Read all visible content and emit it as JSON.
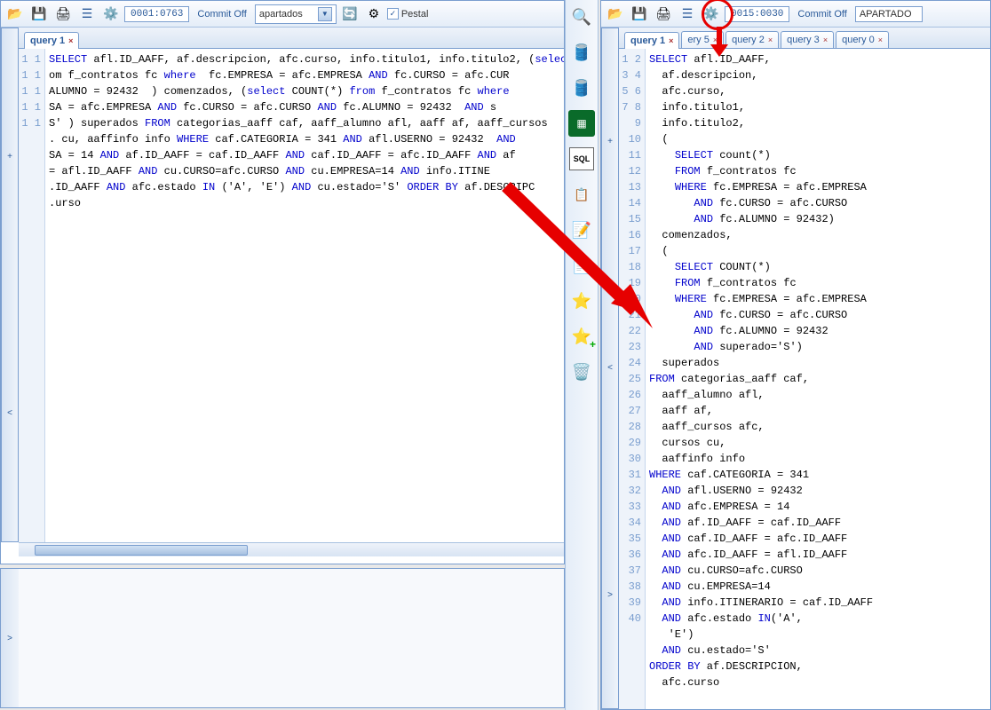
{
  "left": {
    "toolbar": {
      "status": "0001:0763",
      "commit": "Commit Off",
      "dropdown": "apartados",
      "checkbox_label": "Pestal",
      "checkbox_checked": true
    },
    "tabs": [
      {
        "label": "query 1",
        "active": true
      }
    ],
    "gutter": [
      "1",
      "1",
      "1",
      "1",
      "1",
      "1",
      "1",
      "1",
      "1",
      "1"
    ],
    "code_lines": [
      [
        [
          "kw",
          "SELECT"
        ],
        [
          "",
          " afl.ID_AAFF, af.descripcion, afc.curso, info.titulo1, info.titulo2, ("
        ],
        [
          "kw",
          "select "
        ],
        [
          "",
          "c"
        ]
      ],
      [
        [
          "",
          "om f_contratos fc "
        ],
        [
          "kw",
          "where"
        ],
        [
          "",
          "  fc.EMPRESA = afc.EMPRESA "
        ],
        [
          "kw",
          "AND"
        ],
        [
          "",
          " fc.CURSO = afc.CUR"
        ]
      ],
      [
        [
          "",
          "ALUMNO = 92432  ) comenzados, ("
        ],
        [
          "kw",
          "select"
        ],
        [
          "",
          " COUNT(*) "
        ],
        [
          "kw",
          "from"
        ],
        [
          "",
          " f_contratos fc "
        ],
        [
          "kw",
          "where"
        ]
      ],
      [
        [
          "",
          "SA = afc.EMPRESA "
        ],
        [
          "kw",
          "AND"
        ],
        [
          "",
          " fc.CURSO = afc.CURSO "
        ],
        [
          "kw",
          "AND"
        ],
        [
          "",
          " fc.ALUMNO = 92432  "
        ],
        [
          "kw",
          "AND"
        ],
        [
          "",
          " s"
        ]
      ],
      [
        [
          "",
          "S' ) superados "
        ],
        [
          "kw",
          "FROM"
        ],
        [
          "",
          " categorias_aaff caf, aaff_alumno afl, aaff af, aaff_cursos"
        ]
      ],
      [
        [
          "",
          ". cu, aaffinfo info "
        ],
        [
          "kw",
          "WHERE"
        ],
        [
          "",
          " caf.CATEGORIA = 341 "
        ],
        [
          "kw",
          "AND"
        ],
        [
          "",
          " afl.USERNO = 92432  "
        ],
        [
          "kw",
          "AND"
        ]
      ],
      [
        [
          "",
          "SA = 14 "
        ],
        [
          "kw",
          "AND"
        ],
        [
          "",
          " af.ID_AAFF = caf.ID_AAFF "
        ],
        [
          "kw",
          "AND"
        ],
        [
          "",
          " caf.ID_AAFF = afc.ID_AAFF "
        ],
        [
          "kw",
          "AND"
        ],
        [
          "",
          " af"
        ]
      ],
      [
        [
          "",
          "= afl.ID_AAFF "
        ],
        [
          "kw",
          "AND"
        ],
        [
          "",
          " cu.CURSO=afc.CURSO "
        ],
        [
          "kw",
          "AND"
        ],
        [
          "",
          " cu.EMPRESA=14 "
        ],
        [
          "kw",
          "AND"
        ],
        [
          "",
          " info.ITINE"
        ]
      ],
      [
        [
          "",
          ".ID_AAFF "
        ],
        [
          "kw",
          "AND"
        ],
        [
          "",
          " afc.estado "
        ],
        [
          "kw",
          "IN"
        ],
        [
          "",
          " ('A', 'E') "
        ],
        [
          "kw",
          "AND"
        ],
        [
          "",
          " cu.estado='S' "
        ],
        [
          "kw",
          "ORDER BY"
        ],
        [
          "",
          " af.DESCRIPC"
        ]
      ],
      [
        [
          "",
          ".urso"
        ]
      ]
    ]
  },
  "right": {
    "toolbar": {
      "status": "0015:0030",
      "commit": "Commit Off",
      "dropdown": "APARTADO"
    },
    "tabs": [
      {
        "label": "query 1",
        "active": true
      },
      {
        "label": "ery 5",
        "active": false,
        "clipped": true
      },
      {
        "label": "query 2",
        "active": false
      },
      {
        "label": "query 3",
        "active": false
      },
      {
        "label": "query 0",
        "active": false
      }
    ],
    "code": [
      {
        "n": 1,
        "seg": [
          [
            "kw",
            "SELECT"
          ],
          [
            "",
            " afl.ID_AAFF,"
          ]
        ]
      },
      {
        "n": 2,
        "seg": [
          [
            "",
            "  af.descripcion,"
          ]
        ]
      },
      {
        "n": 3,
        "seg": [
          [
            "",
            "  afc.curso,"
          ]
        ]
      },
      {
        "n": 4,
        "seg": [
          [
            "",
            "  info.titulo1,"
          ]
        ]
      },
      {
        "n": 5,
        "seg": [
          [
            "",
            "  info.titulo2,"
          ]
        ]
      },
      {
        "n": 6,
        "seg": [
          [
            "",
            "  ("
          ]
        ]
      },
      {
        "n": 7,
        "seg": [
          [
            "",
            "    "
          ],
          [
            "kw",
            "SELECT"
          ],
          [
            "",
            " count(*)"
          ]
        ]
      },
      {
        "n": 8,
        "seg": [
          [
            "",
            "    "
          ],
          [
            "kw",
            "FROM"
          ],
          [
            "",
            " f_contratos fc"
          ]
        ]
      },
      {
        "n": 9,
        "seg": [
          [
            "",
            "    "
          ],
          [
            "kw",
            "WHERE"
          ],
          [
            "",
            " fc.EMPRESA = afc.EMPRESA"
          ]
        ]
      },
      {
        "n": 10,
        "seg": [
          [
            "",
            "       "
          ],
          [
            "kw",
            "AND"
          ],
          [
            "",
            " fc.CURSO = afc.CURSO"
          ]
        ]
      },
      {
        "n": 11,
        "seg": [
          [
            "",
            "       "
          ],
          [
            "kw",
            "AND"
          ],
          [
            "",
            " fc.ALUMNO = 92432)"
          ]
        ]
      },
      {
        "n": 12,
        "seg": [
          [
            "",
            "  comenzados,"
          ]
        ]
      },
      {
        "n": 13,
        "seg": [
          [
            "",
            "  ("
          ]
        ]
      },
      {
        "n": 14,
        "seg": [
          [
            "",
            "    "
          ],
          [
            "kw",
            "SELECT"
          ],
          [
            "",
            " COUNT(*)"
          ]
        ]
      },
      {
        "n": 15,
        "seg": [
          [
            "",
            "    "
          ],
          [
            "kw",
            "FROM"
          ],
          [
            "",
            " f_contratos fc"
          ]
        ]
      },
      {
        "n": 16,
        "seg": [
          [
            "",
            "    "
          ],
          [
            "kw",
            "WHERE"
          ],
          [
            "",
            " fc.EMPRESA = afc.EMPRESA"
          ]
        ]
      },
      {
        "n": 17,
        "seg": [
          [
            "",
            "       "
          ],
          [
            "kw",
            "AND"
          ],
          [
            "",
            " fc.CURSO = afc.CURSO"
          ]
        ]
      },
      {
        "n": 18,
        "seg": [
          [
            "",
            "       "
          ],
          [
            "kw",
            "AND"
          ],
          [
            "",
            " fc.ALUMNO = 92432"
          ]
        ]
      },
      {
        "n": 19,
        "seg": [
          [
            "",
            "       "
          ],
          [
            "kw",
            "AND"
          ],
          [
            "",
            " superado='S')"
          ]
        ]
      },
      {
        "n": 20,
        "seg": [
          [
            "",
            "  superados"
          ]
        ]
      },
      {
        "n": 21,
        "seg": [
          [
            "kw",
            "FROM"
          ],
          [
            "",
            " categorias_aaff caf,"
          ]
        ]
      },
      {
        "n": 22,
        "seg": [
          [
            "",
            "  aaff_alumno afl,"
          ]
        ]
      },
      {
        "n": 23,
        "seg": [
          [
            "",
            "  aaff af,"
          ]
        ]
      },
      {
        "n": 24,
        "seg": [
          [
            "",
            "  aaff_cursos afc,"
          ]
        ]
      },
      {
        "n": 25,
        "seg": [
          [
            "",
            "  cursos cu,"
          ]
        ]
      },
      {
        "n": 26,
        "seg": [
          [
            "",
            "  aaffinfo info"
          ]
        ]
      },
      {
        "n": 27,
        "seg": [
          [
            "kw",
            "WHERE"
          ],
          [
            "",
            " caf.CATEGORIA = 341"
          ]
        ]
      },
      {
        "n": 28,
        "seg": [
          [
            "",
            "  "
          ],
          [
            "kw",
            "AND"
          ],
          [
            "",
            " afl.USERNO = 92432"
          ]
        ]
      },
      {
        "n": 29,
        "seg": [
          [
            "",
            "  "
          ],
          [
            "kw",
            "AND"
          ],
          [
            "",
            " afc.EMPRESA = 14"
          ]
        ]
      },
      {
        "n": 30,
        "seg": [
          [
            "",
            "  "
          ],
          [
            "kw",
            "AND"
          ],
          [
            "",
            " af.ID_AAFF = caf.ID_AAFF"
          ]
        ]
      },
      {
        "n": 31,
        "seg": [
          [
            "",
            "  "
          ],
          [
            "kw",
            "AND"
          ],
          [
            "",
            " caf.ID_AAFF = afc.ID_AAFF"
          ]
        ]
      },
      {
        "n": 32,
        "seg": [
          [
            "",
            "  "
          ],
          [
            "kw",
            "AND"
          ],
          [
            "",
            " afc.ID_AAFF = afl.ID_AAFF"
          ]
        ]
      },
      {
        "n": 33,
        "seg": [
          [
            "",
            "  "
          ],
          [
            "kw",
            "AND"
          ],
          [
            "",
            " cu.CURSO=afc.CURSO"
          ]
        ]
      },
      {
        "n": 34,
        "seg": [
          [
            "",
            "  "
          ],
          [
            "kw",
            "AND"
          ],
          [
            "",
            " cu.EMPRESA=14"
          ]
        ]
      },
      {
        "n": 35,
        "seg": [
          [
            "",
            "  "
          ],
          [
            "kw",
            "AND"
          ],
          [
            "",
            " info.ITINERARIO = caf.ID_AAFF"
          ]
        ]
      },
      {
        "n": 36,
        "seg": [
          [
            "",
            "  "
          ],
          [
            "kw",
            "AND"
          ],
          [
            "",
            " afc.estado "
          ],
          [
            "kw",
            "IN"
          ],
          [
            "",
            "('A',"
          ]
        ]
      },
      {
        "n": 37,
        "seg": [
          [
            "",
            "   'E')"
          ]
        ]
      },
      {
        "n": 38,
        "seg": [
          [
            "",
            "  "
          ],
          [
            "kw",
            "AND"
          ],
          [
            "",
            " cu.estado='S'"
          ]
        ]
      },
      {
        "n": 39,
        "seg": [
          [
            "kw",
            "ORDER BY"
          ],
          [
            "",
            " af.DESCRIPCION,"
          ]
        ]
      },
      {
        "n": 40,
        "seg": [
          [
            "",
            "  afc.curso"
          ]
        ]
      }
    ]
  },
  "strip": {
    "sql_label": "SQL"
  },
  "sidebar_symbols": {
    "plus": "+",
    "minus": "<",
    "gt": ">"
  }
}
